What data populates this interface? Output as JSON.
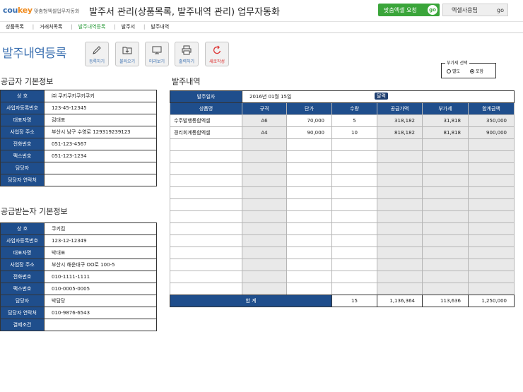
{
  "header": {
    "logo_main": "cou",
    "logo_accent": "key",
    "subtitle": "맞춤형엑셀업무자동화",
    "title": "발주서 관리(상품목록, 발주내역 관리) 업무자동화",
    "custom_request_label": "맞춤엑셀 요청",
    "custom_request_go": "go",
    "tips_label": "엑셀사용팁",
    "tips_go": "go"
  },
  "menu": {
    "items": [
      "상품목록",
      "거래처목록",
      "발주내역등록",
      "발주서",
      "발주내역"
    ],
    "active_index": 2,
    "separator": "|"
  },
  "page": {
    "title": "발주내역등록"
  },
  "toolbar": {
    "register": "등록하기",
    "load": "불러오기",
    "preview": "미리보기",
    "print": "출력하기",
    "new": "새로작성"
  },
  "vat": {
    "legend": "부가세 선택",
    "separate": "별도",
    "included": "포함",
    "selected": "included"
  },
  "supplier": {
    "title": "공급자 기본정보",
    "rows": [
      {
        "label": "상 호",
        "value": "㈜ 쿠키쿠키쿠키쿠키"
      },
      {
        "label": "사업자등록번호",
        "value": "123-45-12345"
      },
      {
        "label": "대표자명",
        "value": "김대표"
      },
      {
        "label": "사업장 주소",
        "value": "부산시 남구 수영로 129319239123"
      },
      {
        "label": "전화번호",
        "value": "051-123-4567"
      },
      {
        "label": "팩스번호",
        "value": "051-123-1234"
      },
      {
        "label": "담당자",
        "value": ""
      },
      {
        "label": "담당자 연락처",
        "value": ""
      }
    ]
  },
  "receiver": {
    "title": "공급받는자 기본정보",
    "rows": [
      {
        "label": "상 호",
        "value": "쿠키킴"
      },
      {
        "label": "사업자등록번호",
        "value": "123-12-12349"
      },
      {
        "label": "대표자명",
        "value": "박대표"
      },
      {
        "label": "사업장 주소",
        "value": "부산시 해운대구 OO로 100-5"
      },
      {
        "label": "전화번호",
        "value": "010-1111-1111"
      },
      {
        "label": "팩스번호",
        "value": "010-0005-0005"
      },
      {
        "label": "담당자",
        "value": "박담당"
      },
      {
        "label": "담당자 연락처",
        "value": "010-9876-6543"
      },
      {
        "label": "결제조건",
        "value": ""
      }
    ]
  },
  "order": {
    "title": "발주내역",
    "date_label": "발주일자",
    "date_value": "2016년 01월 15일",
    "calendar_tip": "달력",
    "columns": [
      "상품명",
      "규격",
      "단가",
      "수량",
      "공급가액",
      "부가세",
      "합계금액"
    ],
    "rows": [
      [
        "수주발행통합엑셀",
        "A6",
        "70,000",
        "5",
        "318,182",
        "31,818",
        "350,000"
      ],
      [
        "경리회계통합엑셀",
        "A4",
        "90,000",
        "10",
        "818,182",
        "81,818",
        "900,000"
      ]
    ],
    "total_label": "합 계",
    "total": {
      "qty": "15",
      "supply": "1,136,364",
      "vat": "113,636",
      "sum": "1,250,000"
    }
  }
}
